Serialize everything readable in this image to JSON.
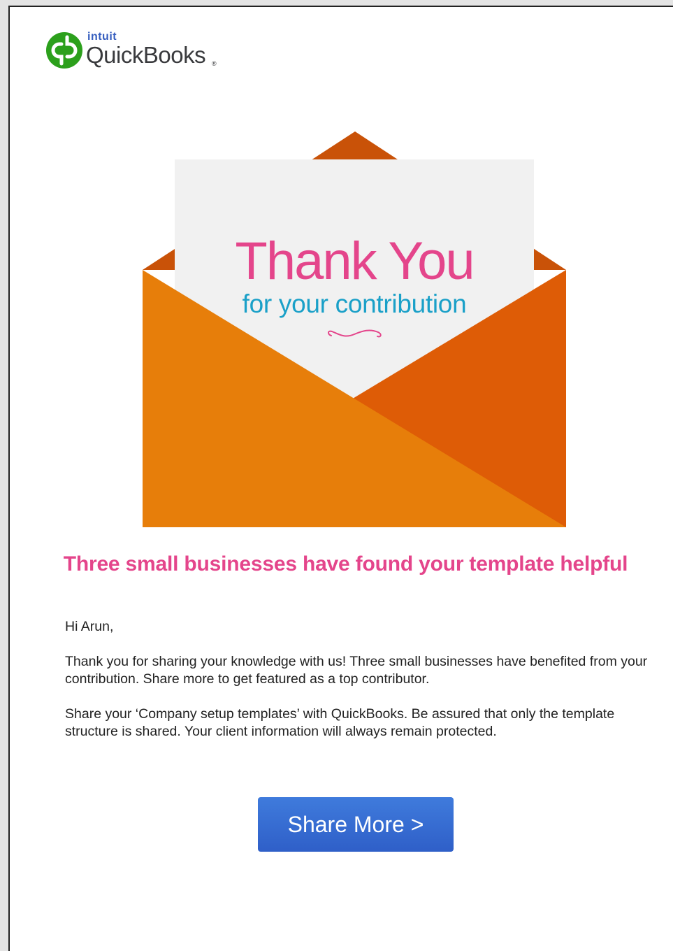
{
  "brand": {
    "company": "intuit",
    "product": "QuickBooks",
    "trademark": "®",
    "badge_icon": "qb-logo-icon",
    "badge_color": "#2ca01c",
    "intuit_color": "#365ebf"
  },
  "hero": {
    "title": "Thank You",
    "subtitle": "for your contribution",
    "envelope_colors": {
      "flap": "#c95208",
      "left": "#e77e0a",
      "right": "#de5c06",
      "card": "#f1f1f1"
    }
  },
  "headline": "Three small businesses have found your template helpful",
  "body": {
    "greeting": "Hi Arun,",
    "paragraph1": "Thank you for sharing your knowledge with us! Three small businesses have benefited from your contribution. Share more to get featured as a top contributor.",
    "paragraph2": "Share your ‘Company setup templates’ with QuickBooks. Be assured that only the template structure is shared. Your client information will always remain protected."
  },
  "cta": {
    "label": "Share More >",
    "color": "#3169d1"
  },
  "colors": {
    "accent_pink": "#e4458b",
    "accent_blue": "#1aa0c8"
  }
}
